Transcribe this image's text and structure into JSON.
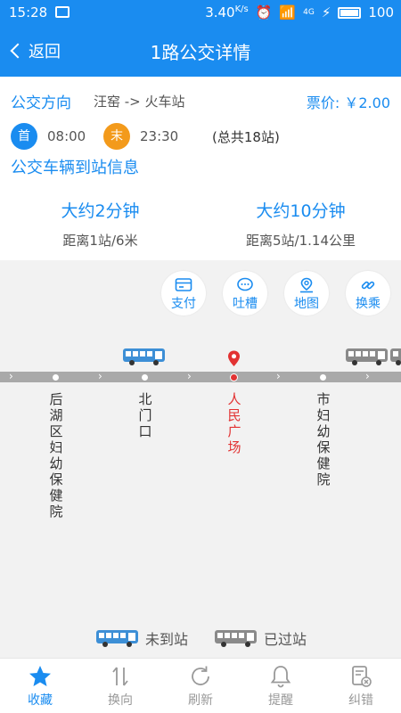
{
  "status_bar": {
    "time": "15:28",
    "speed": "3.40",
    "speed_unit": "K/s",
    "network": "4G",
    "battery": "100"
  },
  "nav": {
    "back_label": "返回",
    "title": "1路公交详情"
  },
  "route": {
    "direction_label": "公交方向",
    "direction_value": "汪窑 -> 火车站",
    "fare": "票价: ￥2.00",
    "first_badge": "首",
    "first_time": "08:00",
    "last_badge": "末",
    "last_time": "23:30",
    "total_stops": "(总共18站)"
  },
  "arrival": {
    "title": "公交车辆到站信息",
    "buses": [
      {
        "eta": "大约2分钟",
        "distance": "距离1站/6米"
      },
      {
        "eta": "大约10分钟",
        "distance": "距离5站/1.14公里"
      }
    ]
  },
  "actions": [
    {
      "label": "支付",
      "icon": "payment-card-icon"
    },
    {
      "label": "吐槽",
      "icon": "comment-bubble-icon"
    },
    {
      "label": "地图",
      "icon": "map-pin-icon"
    },
    {
      "label": "换乘",
      "icon": "transfer-link-icon"
    }
  ],
  "stops": [
    {
      "name": "后湖区妇幼保健院",
      "current": false
    },
    {
      "name": "北门口",
      "current": false
    },
    {
      "name": "人民广场",
      "current": true
    },
    {
      "name": "市妇幼保健院",
      "current": false
    }
  ],
  "legend": {
    "arriving": "未到站",
    "passed": "已过站"
  },
  "tabs": [
    {
      "label": "收藏",
      "icon": "star-icon",
      "active": true
    },
    {
      "label": "换向",
      "icon": "swap-direction-icon",
      "active": false
    },
    {
      "label": "刷新",
      "icon": "refresh-icon",
      "active": false
    },
    {
      "label": "提醒",
      "icon": "bell-icon",
      "active": false
    },
    {
      "label": "纠错",
      "icon": "report-error-icon",
      "active": false
    }
  ],
  "colors": {
    "primary": "#1a8cf0",
    "last_badge": "#f39a1b",
    "current_stop": "#e23232",
    "road": "#a9a9a9",
    "bus_incoming": "#3d8fd6",
    "bus_passed": "#8a8a8a"
  }
}
